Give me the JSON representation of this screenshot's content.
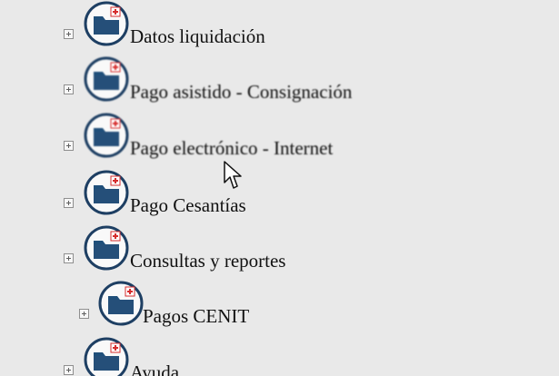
{
  "tree": {
    "items": [
      {
        "label": "Datos liquidación",
        "icon": "folder-add-icon",
        "expand_icon": "plus-box-icon",
        "level": 0
      },
      {
        "label": "Pago asistido - Consignación",
        "icon": "folder-add-icon",
        "expand_icon": "plus-box-icon",
        "level": 0
      },
      {
        "label": "Pago electrónico - Internet",
        "icon": "folder-add-icon",
        "expand_icon": "plus-box-icon",
        "level": 0
      },
      {
        "label": "Pago Cesantías",
        "icon": "folder-add-icon",
        "expand_icon": "plus-box-icon",
        "level": 0
      },
      {
        "label": "Consultas y reportes",
        "icon": "folder-add-icon",
        "expand_icon": "plus-box-icon",
        "level": 0
      },
      {
        "label": "Pagos CENIT",
        "icon": "folder-add-icon",
        "expand_icon": "plus-box-icon",
        "level": 1
      },
      {
        "label": "Ayuda",
        "icon": "folder-add-icon",
        "expand_icon": "plus-box-icon",
        "level": 0
      }
    ]
  },
  "colors": {
    "background": "#e9e9e9",
    "folder_fill": "#1f4f7a",
    "folder_ring": "#1e3f63",
    "plus_red": "#d62d2d",
    "text": "#111111"
  },
  "cursor": {
    "icon": "arrow-cursor-icon"
  }
}
